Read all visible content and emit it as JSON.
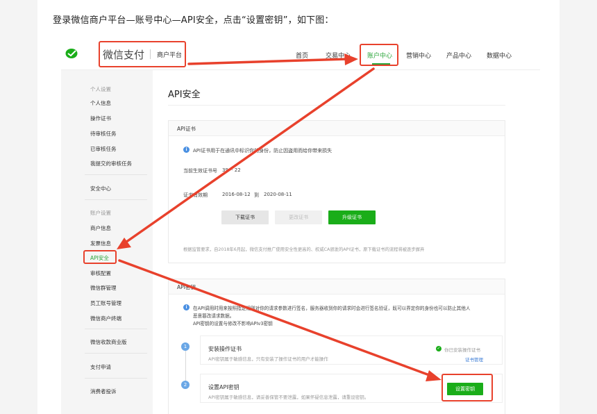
{
  "intro_text": "登录微信商户平台—账号中心—API安全，点击“设置密钥”，如下图：",
  "header": {
    "logo_text": "微信支付",
    "logo_sub": "商户平台",
    "nav": [
      "首页",
      "交易中心",
      "账户中心",
      "营销中心",
      "产品中心",
      "数据中心"
    ],
    "active_nav": "账户中心"
  },
  "sidebar": {
    "groups": [
      {
        "head": "个人设置",
        "items": [
          "个人信息",
          "操作证书",
          "待审核任务",
          "已审核任务",
          "我提交的审核任务"
        ]
      },
      {
        "head": "",
        "items": [
          "安全中心"
        ]
      },
      {
        "head": "账户设置",
        "items": [
          "商户信息",
          "发票信息",
          "API安全",
          "审核配置",
          "微信群管理",
          "员工账号管理",
          "微信商户终端"
        ]
      },
      {
        "head": "",
        "items": [
          "微信收款商业版"
        ]
      },
      {
        "head": "",
        "items": [
          "支付申请"
        ]
      },
      {
        "head": "",
        "items": [
          "消费者投诉"
        ]
      }
    ],
    "active_item": "API安全"
  },
  "main": {
    "title": "API安全",
    "cert_card": {
      "header": "API证书",
      "info": "API证书用于在通讯中标识你的身份，防止因盗用而给你带来损失",
      "serial_label": "当前生效证书号",
      "serial_value": "39··· 22",
      "validity_label": "证书有效期",
      "validity_from": "2016-08-12",
      "validity_to_word": "到",
      "validity_to": "2020-08-11",
      "btn_download": "下载证书",
      "btn_replace": "更改证书",
      "btn_upgrade": "升级证书",
      "footnote": "根据监管要求，自2018年6月起，微信支付推广使用安全性更高的、权威CA颁发的API证书，原下载证书的流程将被逐步摒弃"
    },
    "key_card": {
      "header": "API密钥",
      "info_line1": "在API调用时用来按照指定规则对你的请求参数进行签名，服务器收到你的请求时会进行签名验证，既可以界定你的身份也可以防止其他人",
      "info_line2": "恶意篡改请求数据。",
      "info_line3": "API密钥的设置与修改不影响APIv3密钥",
      "step1_num": "1",
      "step1_title": "安装操作证书",
      "step1_desc": "API密钥属于敏感信息，只有安装了操作证书的用户才能操作",
      "step1_status": "你已安装操作证书",
      "step1_link": "证书管理",
      "step2_num": "2",
      "step2_title": "设置API密钥",
      "step2_desc": "API密钥属于敏感信息，请妥善保管不要泄露，如果怀疑信息泄露，请重设密钥。",
      "step2_button": "设置密钥"
    }
  },
  "colors": {
    "accent_green": "#1aad19",
    "annotation_red": "#e8412c",
    "info_blue": "#4a90e2"
  }
}
